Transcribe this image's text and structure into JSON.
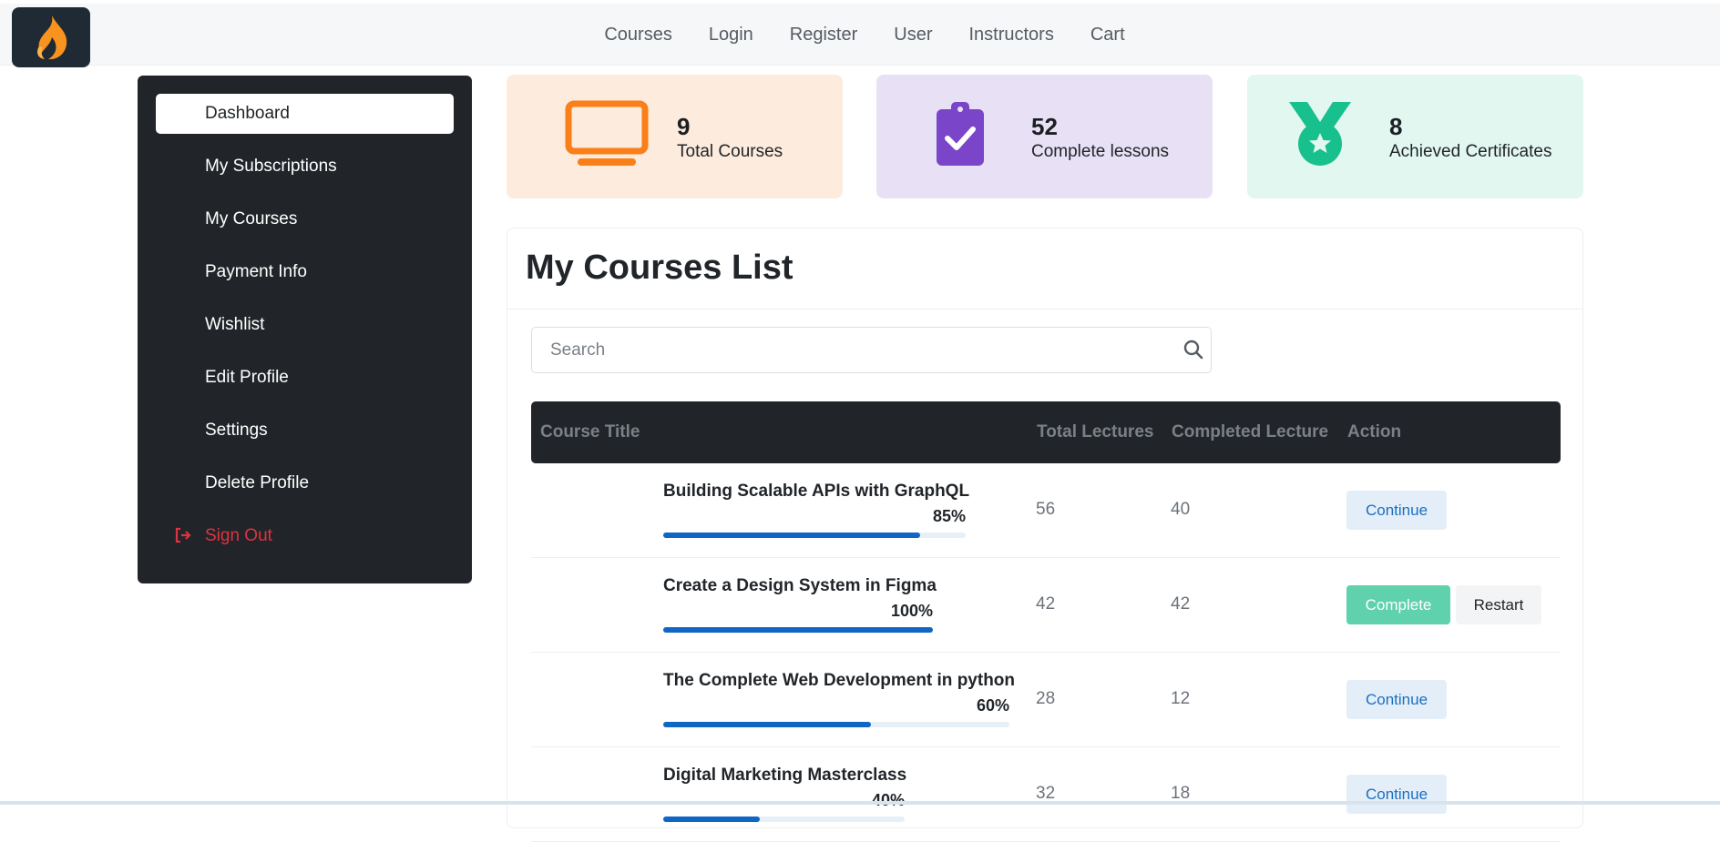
{
  "nav": {
    "items": [
      "Courses",
      "Login",
      "Register",
      "User",
      "Instructors",
      "Cart"
    ]
  },
  "colors": {
    "sidebar_bg": "#212529",
    "accent_blue": "#0f66c4",
    "signout_red": "#e0323f",
    "stat_orange": "#f97f18",
    "stat_purple": "#7a45c9",
    "stat_green": "#18c08e"
  },
  "sidebar": {
    "items": [
      {
        "label": "Dashboard",
        "active": true
      },
      {
        "label": "My Subscriptions"
      },
      {
        "label": "My Courses"
      },
      {
        "label": "Payment Info"
      },
      {
        "label": "Wishlist"
      },
      {
        "label": "Edit Profile"
      },
      {
        "label": "Settings"
      },
      {
        "label": "Delete Profile"
      }
    ],
    "signout": {
      "label": "Sign Out",
      "icon": "sign-out-icon"
    }
  },
  "stats": [
    {
      "value": "9",
      "label": "Total Courses",
      "icon": "monitor-icon"
    },
    {
      "value": "52",
      "label": "Complete lessons",
      "icon": "clipboard-check-icon"
    },
    {
      "value": "8",
      "label": "Achieved Certificates",
      "icon": "medal-icon"
    }
  ],
  "courses": {
    "title": "My Courses List",
    "search_placeholder": "Search",
    "columns": [
      "Course Title",
      "Total Lectures",
      "Completed Lecture",
      "Action"
    ],
    "rows": [
      {
        "title": "Building Scalable APIs with GraphQL",
        "progress": "85%",
        "progress_value": 0.85,
        "total": "56",
        "completed": "40",
        "action": "Continue"
      },
      {
        "title": "Create a Design System in Figma",
        "progress": "100%",
        "progress_value": 1.0,
        "total": "42",
        "completed": "42",
        "action": "Complete",
        "secondary_action": "Restart"
      },
      {
        "title": "The Complete Web Development in python",
        "progress": "60%",
        "progress_value": 0.6,
        "total": "28",
        "completed": "12",
        "action": "Continue"
      },
      {
        "title": "Digital Marketing Masterclass",
        "progress": "40%",
        "progress_value": 0.4,
        "total": "32",
        "completed": "18",
        "action": "Continue"
      }
    ]
  }
}
